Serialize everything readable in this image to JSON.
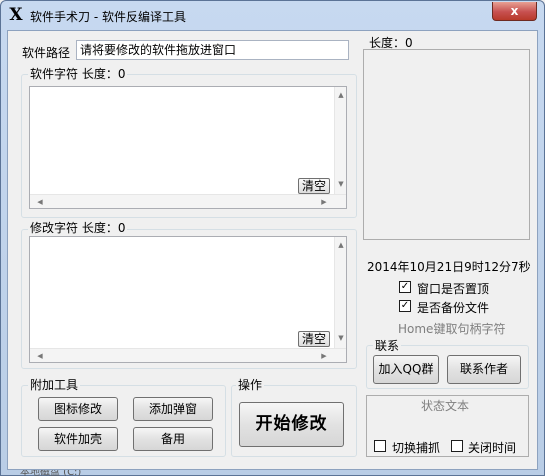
{
  "window": {
    "title": "软件手术刀 - 软件反编译工具",
    "icon": "X",
    "close_glyph": "x"
  },
  "path": {
    "label": "软件路径",
    "value": "请将要修改的软件拖放进窗口"
  },
  "software_chars": {
    "title": "软件字符 长度：0",
    "value": "",
    "clear_label": "清空"
  },
  "modify_chars": {
    "title": "修改字符 长度：0",
    "value": "",
    "clear_label": "清空"
  },
  "right_panel": {
    "length_label": "长度：0",
    "datetime": "2014年10月21日9时12分7秒",
    "checkboxes": [
      {
        "label": "窗口是否置顶",
        "checked": true
      },
      {
        "label": "是否备份文件",
        "checked": true
      }
    ],
    "hint": "Home键取句柄字符"
  },
  "contact": {
    "title": "联系",
    "add_qq_label": "加入QQ群",
    "contact_author_label": "联系作者"
  },
  "status": {
    "title": "状态文本",
    "options": [
      {
        "label": "切换捕抓",
        "checked": false
      },
      {
        "label": "关闭时间",
        "checked": false
      }
    ]
  },
  "tools": {
    "title": "附加工具",
    "icon_modify": "图标修改",
    "add_popup": "添加弹窗",
    "add_shell": "软件加壳",
    "spare": "备用"
  },
  "operation": {
    "title": "操作",
    "start_label": "开始修改"
  },
  "taskbar_peek": "本地磁盘 (C:)"
}
